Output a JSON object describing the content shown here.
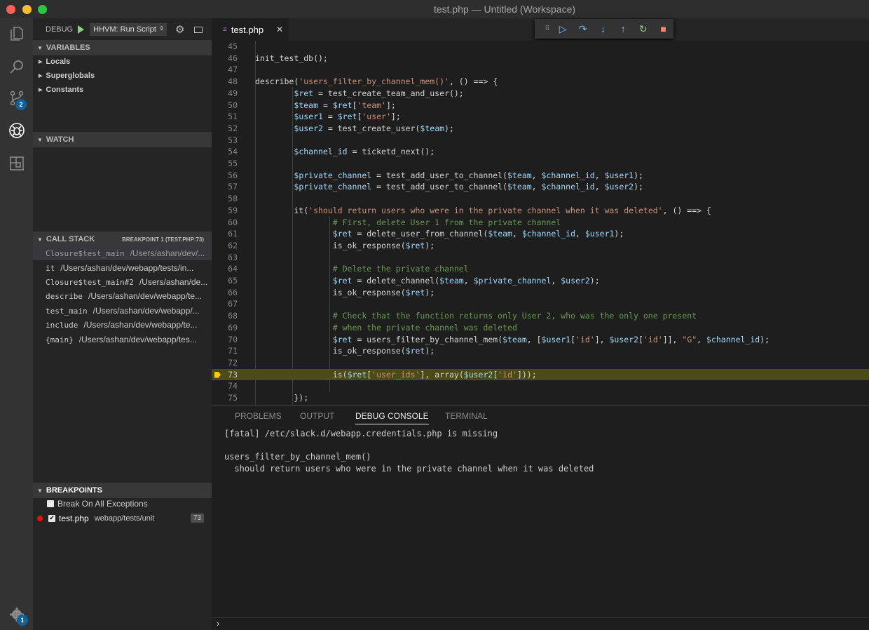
{
  "window": {
    "title": "test.php — Untitled (Workspace)"
  },
  "activity": {
    "scm_badge": "2",
    "settings_badge": "1"
  },
  "debug": {
    "label": "DEBUG",
    "config": "HHVM: Run Script"
  },
  "variables": {
    "title": "VARIABLES",
    "scopes": [
      "Locals",
      "Superglobals",
      "Constants"
    ]
  },
  "watch": {
    "title": "WATCH"
  },
  "callstack": {
    "title": "CALL STACK",
    "status": "BREAKPOINT 1 (TEST.PHP:73)",
    "frames": [
      {
        "fn": "Closure$test_main",
        "path": "/Users/ashan/dev/..."
      },
      {
        "fn": "it",
        "path": "/Users/ashan/dev/webapp/tests/in..."
      },
      {
        "fn": "Closure$test_main#2",
        "path": "/Users/ashan/de..."
      },
      {
        "fn": "describe",
        "path": "/Users/ashan/dev/webapp/te..."
      },
      {
        "fn": "test_main",
        "path": "/Users/ashan/dev/webapp/..."
      },
      {
        "fn": "include",
        "path": "/Users/ashan/dev/webapp/te..."
      },
      {
        "fn": "{main}",
        "path": "/Users/ashan/dev/webapp/tes..."
      }
    ]
  },
  "breakpoints": {
    "title": "BREAKPOINTS",
    "all_exceptions": "Break On All Exceptions",
    "file": "test.php",
    "dir": "webapp/tests/unit",
    "line": "73"
  },
  "editor": {
    "tab": "test.php",
    "lines": [
      {
        "n": "45",
        "t": ""
      },
      {
        "n": "46",
        "t": "        init_test_db();"
      },
      {
        "n": "47",
        "t": ""
      },
      {
        "n": "48",
        "t": "        describe('users_filter_by_channel_mem()', () ==> {"
      },
      {
        "n": "49",
        "t": "                $ret = test_create_team_and_user();"
      },
      {
        "n": "50",
        "t": "                $team = $ret['team'];"
      },
      {
        "n": "51",
        "t": "                $user1 = $ret['user'];"
      },
      {
        "n": "52",
        "t": "                $user2 = test_create_user($team);"
      },
      {
        "n": "53",
        "t": ""
      },
      {
        "n": "54",
        "t": "                $channel_id = ticketd_next();"
      },
      {
        "n": "55",
        "t": ""
      },
      {
        "n": "56",
        "t": "                $private_channel = test_add_user_to_channel($team, $channel_id, $user1);"
      },
      {
        "n": "57",
        "t": "                $private_channel = test_add_user_to_channel($team, $channel_id, $user2);"
      },
      {
        "n": "58",
        "t": ""
      },
      {
        "n": "59",
        "t": "                it('should return users who were in the private channel when it was deleted', () ==> {"
      },
      {
        "n": "60",
        "t": "                        # First, delete User 1 from the private channel"
      },
      {
        "n": "61",
        "t": "                        $ret = delete_user_from_channel($team, $channel_id, $user1);"
      },
      {
        "n": "62",
        "t": "                        is_ok_response($ret);"
      },
      {
        "n": "63",
        "t": ""
      },
      {
        "n": "64",
        "t": "                        # Delete the private channel"
      },
      {
        "n": "65",
        "t": "                        $ret = delete_channel($team, $private_channel, $user2);"
      },
      {
        "n": "66",
        "t": "                        is_ok_response($ret);"
      },
      {
        "n": "67",
        "t": ""
      },
      {
        "n": "68",
        "t": "                        # Check that the function returns only User 2, who was the only one present"
      },
      {
        "n": "69",
        "t": "                        # when the private channel was deleted"
      },
      {
        "n": "70",
        "t": "                        $ret = users_filter_by_channel_mem($team, [$user1['id'], $user2['id']], \"G\", $channel_id);"
      },
      {
        "n": "71",
        "t": "                        is_ok_response($ret);"
      },
      {
        "n": "72",
        "t": ""
      },
      {
        "n": "73",
        "t": "                        is($ret['user_ids'], array($user2['id']));"
      },
      {
        "n": "74",
        "t": ""
      },
      {
        "n": "75",
        "t": "                });"
      }
    ],
    "current_line": "73"
  },
  "panel": {
    "tabs": [
      "PROBLEMS",
      "OUTPUT",
      "DEBUG CONSOLE",
      "TERMINAL"
    ],
    "active": "DEBUG CONSOLE",
    "console": [
      "[fatal] /etc/slack.d/webapp.credentials.php is missing",
      "",
      "users_filter_by_channel_mem()",
      "  should return users who were in the private channel when it was deleted"
    ],
    "prompt": "›"
  }
}
